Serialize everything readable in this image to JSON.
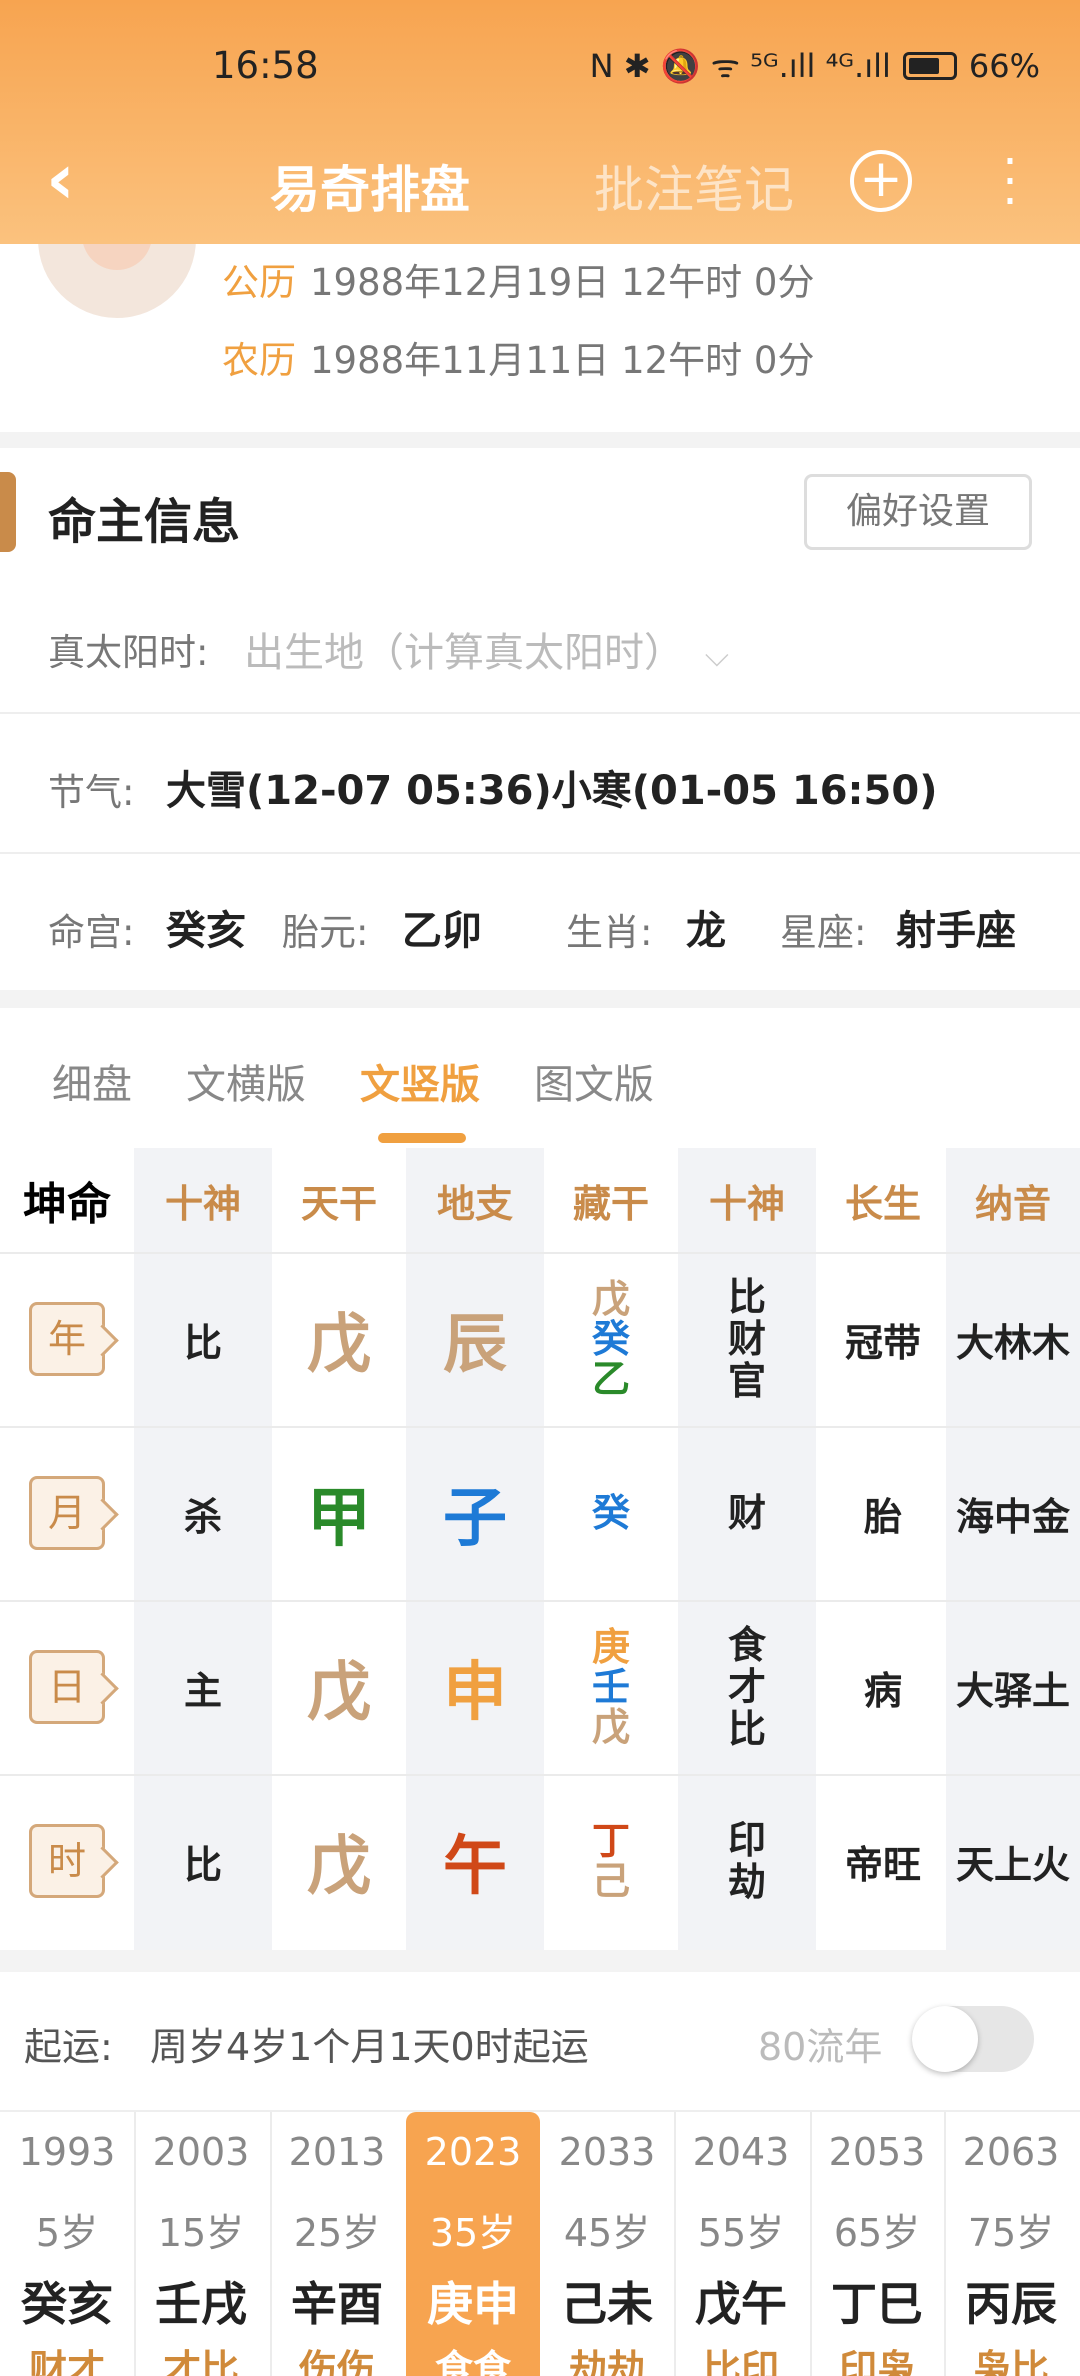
{
  "status": {
    "time": "16:58",
    "icons": "N ✱ 🔕 ᯤ ⁵ᴳ.ıll ⁴ᴳ.ıll",
    "battery": "66%"
  },
  "nav": {
    "back": "‹",
    "title": "易奇排盘",
    "notes": "批注笔记",
    "plus": "+",
    "more": "⋮"
  },
  "profile": {
    "gongli_label": "公历",
    "gongli_value": "1988年12月19日 12午时 0分",
    "nongli_label": "农历",
    "nongli_value": "1988年11月11日 12午时 0分"
  },
  "info": {
    "section_title": "命主信息",
    "pref_button": "偏好设置",
    "true_solar_label": "真太阳时:",
    "true_solar_placeholder": "出生地（计算真太阳时）",
    "jieqi_label": "节气:",
    "jieqi_value": "大雪(12-07 05:36)小寒(01-05 16:50)",
    "minggong_label": "命宫:",
    "minggong_value": "癸亥",
    "taiyuan_label": "胎元:",
    "taiyuan_value": "乙卯",
    "shengxiao_label": "生肖:",
    "shengxiao_value": "龙",
    "xingzuo_label": "星座:",
    "xingzuo_value": "射手座"
  },
  "tabs": [
    "细盘",
    "文横版",
    "文竖版",
    "图文版"
  ],
  "active_tab": "文竖版",
  "grid": {
    "corner": "坤命",
    "headers": [
      "十神",
      "天干",
      "地支",
      "藏干",
      "十神",
      "长生",
      "纳音"
    ],
    "rows": [
      {
        "pillar": "年",
        "shishen": "比",
        "tiangan": "戊",
        "dizhi": "辰",
        "canggan": [
          "戊",
          "癸",
          "乙"
        ],
        "shishen2": "比财官",
        "changsheng": "冠带",
        "nayin": "大林木"
      },
      {
        "pillar": "月",
        "shishen": "杀",
        "tiangan": "甲",
        "dizhi": "子",
        "canggan": [
          "癸"
        ],
        "shishen2": "财",
        "changsheng": "胎",
        "nayin": "海中金"
      },
      {
        "pillar": "日",
        "shishen": "主",
        "tiangan": "戊",
        "dizhi": "申",
        "canggan": [
          "庚",
          "壬",
          "戊"
        ],
        "shishen2": "食才比",
        "changsheng": "病",
        "nayin": "大驿土"
      },
      {
        "pillar": "时",
        "shishen": "比",
        "tiangan": "戊",
        "dizhi": "午",
        "canggan": [
          "丁",
          "己"
        ],
        "shishen2": "印劫",
        "changsheng": "帝旺",
        "nayin": "天上火"
      }
    ],
    "colors": {
      "earth": "#c9a27a",
      "wood": "#2a8a2a",
      "water": "#1e7ad6",
      "metal": "#f0a040",
      "fire": "#d04818"
    }
  },
  "qiyun": {
    "label": "起运:",
    "text": "周岁4岁1个月1天0时起运",
    "liunian": "80流年"
  },
  "dayun": [
    {
      "year": "1993",
      "age": "5岁",
      "gz": "癸亥",
      "ss": "财才"
    },
    {
      "year": "2003",
      "age": "15岁",
      "gz": "壬戌",
      "ss": "才比"
    },
    {
      "year": "2013",
      "age": "25岁",
      "gz": "辛酉",
      "ss": "伤伤"
    },
    {
      "year": "2023",
      "age": "35岁",
      "gz": "庚申",
      "ss": "食食"
    },
    {
      "year": "2033",
      "age": "45岁",
      "gz": "己未",
      "ss": "劫劫"
    },
    {
      "year": "2043",
      "age": "55岁",
      "gz": "戊午",
      "ss": "比印"
    },
    {
      "year": "2053",
      "age": "65岁",
      "gz": "丁巳",
      "ss": "印枭"
    },
    {
      "year": "2063",
      "age": "75岁",
      "gz": "丙辰",
      "ss": "枭比"
    }
  ],
  "active_dayun": "2023"
}
